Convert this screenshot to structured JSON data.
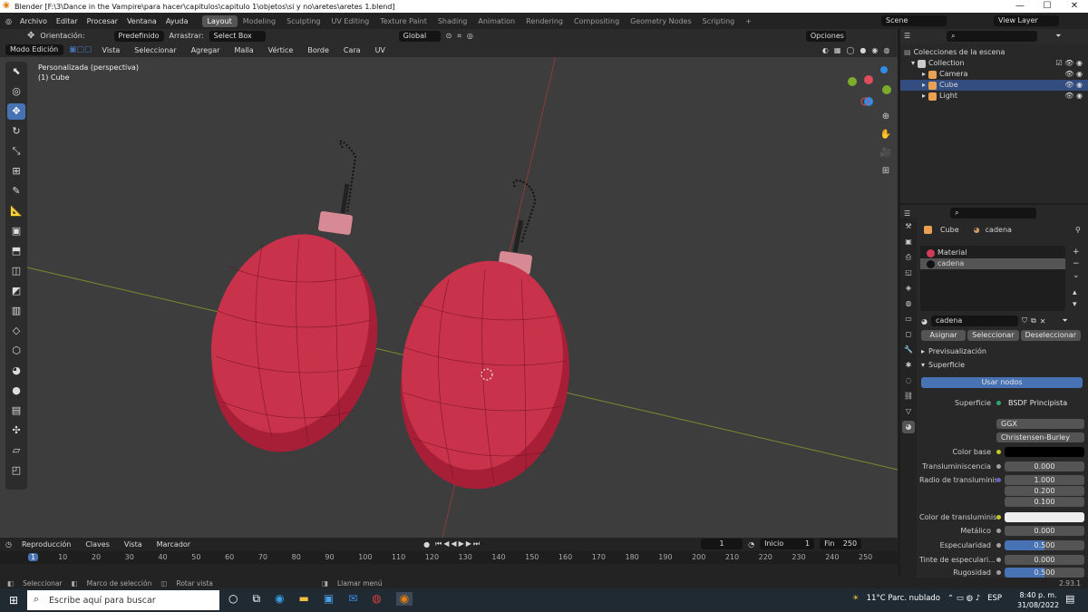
{
  "window": {
    "title": "Blender [F:\\3\\Dance in the Vampire\\para hacer\\capitulos\\capitulo 1\\objetos\\si y no\\aretes\\aretes 1.blend]",
    "minimize": "—",
    "maximize": "☐",
    "close": "✕"
  },
  "menu": [
    "Archivo",
    "Editar",
    "Procesar",
    "Ventana",
    "Ayuda"
  ],
  "workspaces": [
    "Layout",
    "Modeling",
    "Sculpting",
    "UV Editing",
    "Texture Paint",
    "Shading",
    "Animation",
    "Rendering",
    "Compositing",
    "Geometry Nodes",
    "Scripting"
  ],
  "scene": "Scene",
  "view_layer": "View Layer",
  "header1": {
    "orientation_label": "Orientación:",
    "orientation": "Predefinido",
    "drag_label": "Arrastrar:",
    "drag": "Select Box",
    "transform": "Global",
    "options": "Opciones"
  },
  "header2": {
    "mode": "Modo Edición",
    "items": [
      "Vista",
      "Seleccionar",
      "Agregar",
      "Malla",
      "Vértice",
      "Borde",
      "Cara",
      "UV"
    ]
  },
  "viewport": {
    "view_name": "Personalizada (perspectiva)",
    "object": "(1) Cube"
  },
  "outliner": {
    "root": "Colecciones de la escena",
    "collection": "Collection",
    "items": [
      "Camera",
      "Cube",
      "Light"
    ]
  },
  "props": {
    "breadcrumb_obj": "Cube",
    "breadcrumb_mat": "cadena",
    "slots": [
      "Material",
      "cadena"
    ],
    "material_name": "cadena",
    "assign": "Asignar",
    "select": "Seleccionar",
    "deselect": "Deseleccionar",
    "preview": "Previsualización",
    "surface": "Superficie",
    "use_nodes": "Usar nodos",
    "rows": [
      {
        "label": "Superficie",
        "value": "BSDF Principista"
      },
      {
        "label": "",
        "value": "GGX"
      },
      {
        "label": "",
        "value": "Christensen-Burley"
      },
      {
        "label": "Color base",
        "value": ""
      },
      {
        "label": "Transluminiscencia",
        "value": "0.000"
      },
      {
        "label": "Radio de transluminis",
        "value": "1.000"
      },
      {
        "label": "",
        "value": "0.200"
      },
      {
        "label": "",
        "value": "0.100"
      },
      {
        "label": "Color de transluminis",
        "value": ""
      },
      {
        "label": "Metálico",
        "value": "0.000"
      },
      {
        "label": "Especularidad",
        "value": "0.500"
      },
      {
        "label": "Tinte de especulari...",
        "value": "0.000"
      },
      {
        "label": "Rugosidad",
        "value": "0.500"
      }
    ],
    "specular": 0.5,
    "roughness": 0.5
  },
  "timeline": {
    "menu": [
      "Reproducción",
      "Claves",
      "Vista",
      "Marcador"
    ],
    "current_frame": "1",
    "start_label": "Inicio",
    "start": "1",
    "end_label": "Fin",
    "end": "250",
    "ticks": [
      "1",
      "10",
      "20",
      "30",
      "40",
      "50",
      "60",
      "70",
      "80",
      "90",
      "100",
      "110",
      "120",
      "130",
      "140",
      "150",
      "160",
      "170",
      "180",
      "190",
      "200",
      "210",
      "220",
      "230",
      "240",
      "250"
    ]
  },
  "status": {
    "items": [
      "Seleccionar",
      "Marco de selección",
      "Rotar vista",
      "Llamar menú"
    ],
    "version": "2.93.1"
  },
  "taskbar": {
    "search": "Escribe aquí para buscar",
    "weather": "11°C  Parc. nublado",
    "lang": "ESP",
    "time": "8:40 p. m.",
    "date": "31/08/2022"
  },
  "colors": {
    "accent": "#4772b3",
    "earring": "#c8324a"
  }
}
